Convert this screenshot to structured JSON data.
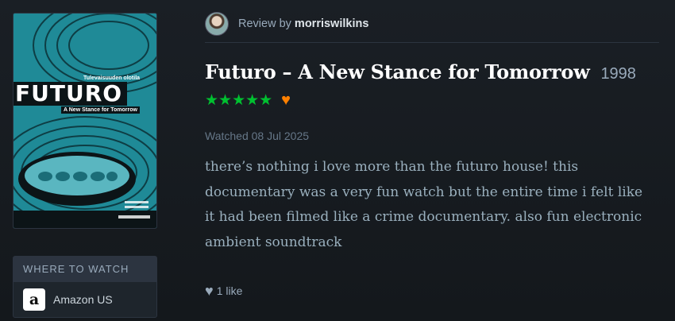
{
  "poster": {
    "title": "FUTURO",
    "top_text": "Tulevaisuuden olotila",
    "subtitle": "A New Stance for Tomorrow"
  },
  "where_to_watch": {
    "heading": "WHERE TO WATCH",
    "services": [
      {
        "name": "Amazon US",
        "icon": "amazon-icon",
        "logo_letter": "a"
      }
    ]
  },
  "review": {
    "by_prefix": "Review by ",
    "username": "morriswilkins",
    "film_title": "Futuro – A New Stance for Tomorrow",
    "year": "1998",
    "rating_stars": 5,
    "star_glyphs": "★★★★★",
    "liked": true,
    "heart_glyph": "♥",
    "watched": "Watched 08 Jul 2025",
    "text": "there’s nothing i love more than the futuro house! this documentary was a very fun watch but the entire time i felt like it had been filmed like a crime documentary. also fun electronic ambient soundtrack",
    "likes_label": "1 like"
  },
  "colors": {
    "background": "#14181c",
    "star": "#00c030",
    "liked_heart": "#ff8000",
    "muted": "#99aabb"
  }
}
